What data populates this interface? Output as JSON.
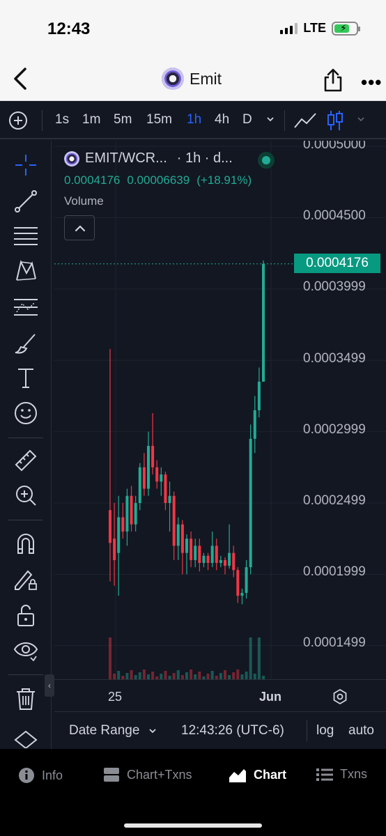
{
  "status": {
    "time": "12:43",
    "network": "LTE"
  },
  "nav": {
    "title": "Emit"
  },
  "toolbar": {
    "intervals": [
      "1s",
      "1m",
      "5m",
      "15m",
      "1h",
      "4h",
      "D"
    ],
    "active_interval": "1h"
  },
  "legend": {
    "symbol": "EMIT/WCR...",
    "meta": "· 1h · d...",
    "price": "0.0004176",
    "change": "0.00006639",
    "change_pct": "(+18.91%)",
    "volume_label": "Volume"
  },
  "price_axis": {
    "labels": [
      "0.0005000",
      "0.0004500",
      "0.0003999",
      "0.0003499",
      "0.0002999",
      "0.0002499",
      "0.0001999",
      "0.0001499"
    ],
    "current": "0.0004176"
  },
  "time_axis": {
    "labels": [
      "25",
      "Jun"
    ]
  },
  "chart_bottom": {
    "date_range": "Date Range",
    "clock": "12:43:26 (UTC-6)",
    "log": "log",
    "auto": "auto"
  },
  "tabs": [
    {
      "label": "Info"
    },
    {
      "label": "Chart+Txns"
    },
    {
      "label": "Chart"
    },
    {
      "label": "Txns"
    }
  ],
  "colors": {
    "up": "#22ab94",
    "down": "#f23645",
    "accent": "#2962ff",
    "background": "#131722"
  },
  "chart_data": {
    "type": "candlestick",
    "series_points": [
      [
        0,
        0.000245,
        0.000222,
        0.000358,
        0.000195
      ],
      [
        1,
        0.000225,
        0.00021,
        0.00025,
        0.000192
      ],
      [
        2,
        0.000215,
        0.00024,
        0.000255,
        0.000185
      ],
      [
        3,
        0.00024,
        0.00023,
        0.00025,
        0.000225
      ],
      [
        4,
        0.00023,
        0.000255,
        0.00026,
        0.00022
      ],
      [
        5,
        0.000255,
        0.000235,
        0.000262,
        0.00023
      ],
      [
        6,
        0.000235,
        0.00025,
        0.000255,
        0.00023
      ],
      [
        7,
        0.00025,
        0.000275,
        0.000278,
        0.000245
      ],
      [
        8,
        0.000275,
        0.00026,
        0.000285,
        0.000255
      ],
      [
        9,
        0.00026,
        0.00029,
        0.0003,
        0.000255
      ],
      [
        10,
        0.00029,
        0.000275,
        0.000313,
        0.00027
      ],
      [
        11,
        0.000275,
        0.000265,
        0.00028,
        0.00026
      ],
      [
        12,
        0.000265,
        0.00027,
        0.000275,
        0.000255
      ],
      [
        13,
        0.00027,
        0.00025,
        0.000272,
        0.000245
      ],
      [
        14,
        0.00025,
        0.000255,
        0.000265,
        0.00023
      ],
      [
        15,
        0.000255,
        0.00022,
        0.000258,
        0.00021
      ],
      [
        16,
        0.00022,
        0.000235,
        0.00024,
        0.00021
      ],
      [
        17,
        0.000235,
        0.000215,
        0.000238,
        0.0002
      ],
      [
        18,
        0.000215,
        0.000225,
        0.000228,
        0.0002
      ],
      [
        19,
        0.000225,
        0.00021,
        0.00023,
        0.000205
      ],
      [
        20,
        0.00021,
        0.00022,
        0.000225,
        0.000205
      ],
      [
        21,
        0.00022,
        0.000208,
        0.000225,
        0.000202
      ],
      [
        22,
        0.000208,
        0.000213,
        0.000215,
        0.000205
      ],
      [
        23,
        0.000213,
        0.000208,
        0.000215,
        0.000203
      ],
      [
        24,
        0.000208,
        0.00022,
        0.00023,
        0.000205
      ],
      [
        25,
        0.00022,
        0.000208,
        0.000225,
        0.000203
      ],
      [
        26,
        0.000208,
        0.00021,
        0.000213,
        0.000205
      ],
      [
        27,
        0.00021,
        0.000206,
        0.000212,
        0.0002
      ],
      [
        28,
        0.000206,
        0.000215,
        0.000235,
        0.000204
      ],
      [
        29,
        0.000215,
        0.000203,
        0.00022,
        0.000198
      ],
      [
        30,
        0.000203,
        0.000185,
        0.000205,
        0.00018
      ],
      [
        31,
        0.000185,
        0.000187,
        0.00019,
        0.000179
      ],
      [
        32,
        0.000187,
        0.000205,
        0.00021,
        0.000183
      ],
      [
        33,
        0.000205,
        0.000295,
        0.000305,
        0.0002
      ],
      [
        34,
        0.000295,
        0.000315,
        0.000325,
        0.000285
      ],
      [
        35,
        0.000315,
        0.000335,
        0.000345,
        0.00031
      ],
      [
        36,
        0.000335,
        0.0004176,
        0.00042,
        0.000335
      ]
    ],
    "ylim": [
      0.00014,
      0.0005
    ],
    "x_ticks": [
      "25",
      "Jun"
    ]
  }
}
